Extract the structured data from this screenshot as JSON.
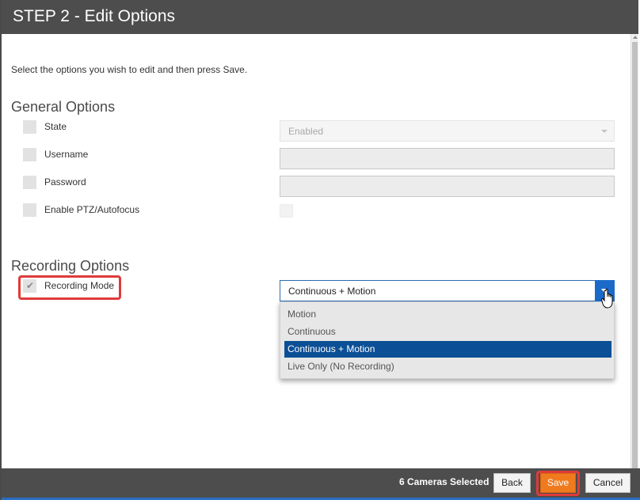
{
  "dialog": {
    "title": "STEP 2 - Edit Options",
    "intro": "Select the options you wish to edit and then press Save."
  },
  "general": {
    "heading": "General Options",
    "state_label": "State",
    "state_value": "Enabled",
    "username_label": "Username",
    "password_label": "Password",
    "ptz_label": "Enable PTZ/Autofocus"
  },
  "recording": {
    "heading": "Recording Options",
    "mode_label": "Recording Mode",
    "mode_checked": true,
    "mode_value": "Continuous + Motion",
    "options": [
      "Motion",
      "Continuous",
      "Continuous + Motion",
      "Live Only (No Recording)"
    ],
    "selected_index": 2
  },
  "footer": {
    "count_text": "6 Cameras Selected",
    "back_label": "Back",
    "save_label": "Save",
    "cancel_label": "Cancel"
  },
  "colors": {
    "titlebar": "#4d4d4d",
    "accent_blue": "#0b4f96",
    "save_orange": "#f07a1e",
    "highlight_red": "#e03a3a"
  },
  "icons": [
    "checkmark-icon",
    "chevron-down-icon",
    "hand-pointer-cursor-icon"
  ]
}
